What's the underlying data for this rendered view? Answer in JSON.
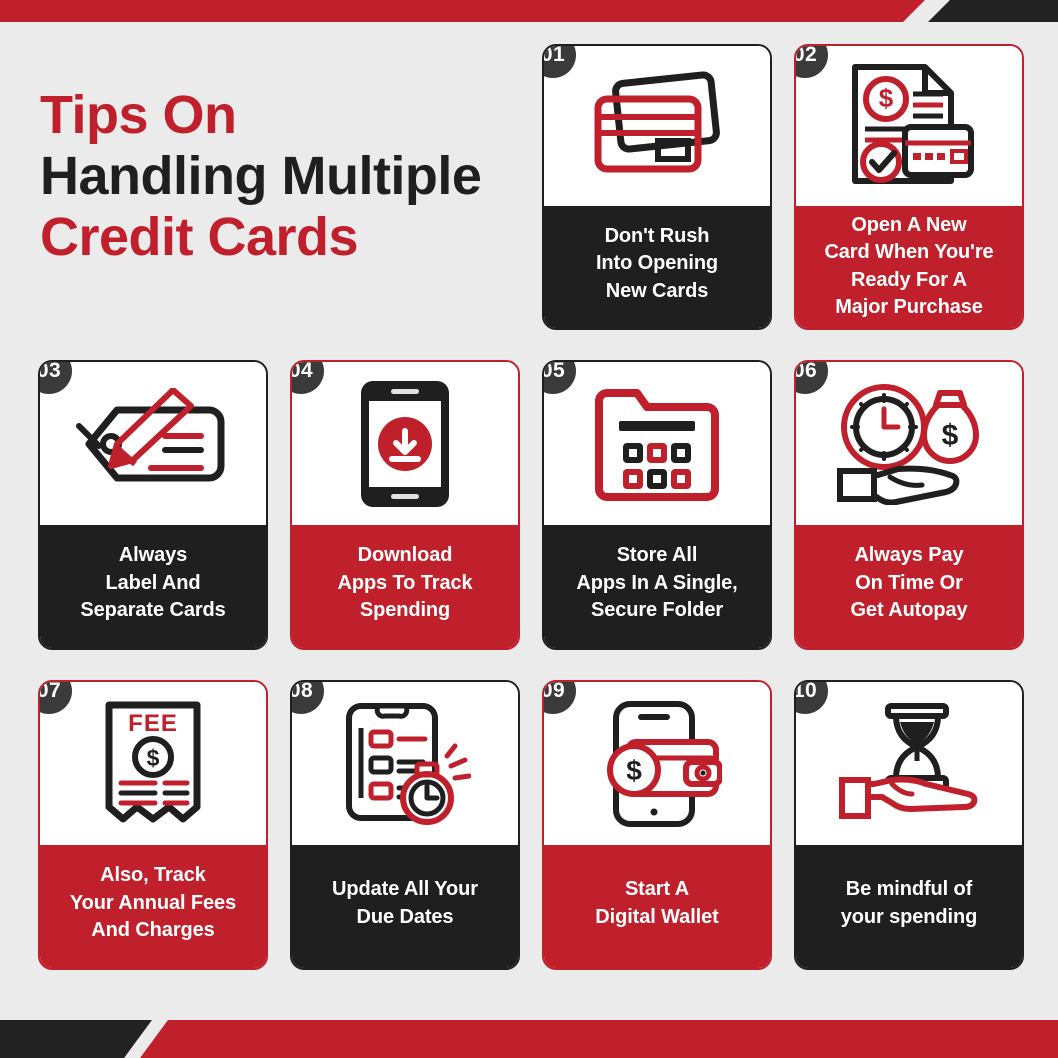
{
  "headline": {
    "line1": "Tips On",
    "line2": "Handling Multiple",
    "line3": "Credit Cards"
  },
  "colors": {
    "red": "#C0202B",
    "dark": "#1F1F1F",
    "badge": "#3A3A3A",
    "background": "#EBEBEB",
    "panel_text": "#FFFFFF"
  },
  "cards": [
    {
      "number": "01",
      "theme": "dark",
      "icon": "stacked-credit-cards-icon",
      "label": "Don't Rush\nInto Opening\nNew Cards"
    },
    {
      "number": "02",
      "theme": "red",
      "icon": "document-dollar-card-icon",
      "label": "Open A New\nCard When You're\nReady For A\nMajor Purchase"
    },
    {
      "number": "03",
      "theme": "dark",
      "icon": "tag-pencil-label-icon",
      "label": "Always\nLabel And\nSeparate Cards"
    },
    {
      "number": "04",
      "theme": "red",
      "icon": "phone-download-app-icon",
      "label": "Download\nApps To Track\nSpending"
    },
    {
      "number": "05",
      "theme": "dark",
      "icon": "folder-apps-grid-icon",
      "label": "Store All\nApps In A Single,\nSecure Folder"
    },
    {
      "number": "06",
      "theme": "red",
      "icon": "clock-money-bag-hand-icon",
      "label": "Always Pay\nOn Time Or\nGet Autopay"
    },
    {
      "number": "07",
      "theme": "red",
      "icon": "fee-receipt-dollar-icon",
      "label": "Also, Track\nYour Annual Fees\nAnd Charges"
    },
    {
      "number": "08",
      "theme": "dark",
      "icon": "checklist-alarm-clock-icon",
      "label": "Update All Your\nDue Dates"
    },
    {
      "number": "09",
      "theme": "red",
      "icon": "phone-wallet-dollar-icon",
      "label": "Start A\nDigital Wallet"
    },
    {
      "number": "10",
      "theme": "dark",
      "icon": "hourglass-hand-icon",
      "label": "Be mindful of\nyour spending"
    }
  ],
  "icon_texts": {
    "fee": "FEE",
    "dollar": "$"
  }
}
